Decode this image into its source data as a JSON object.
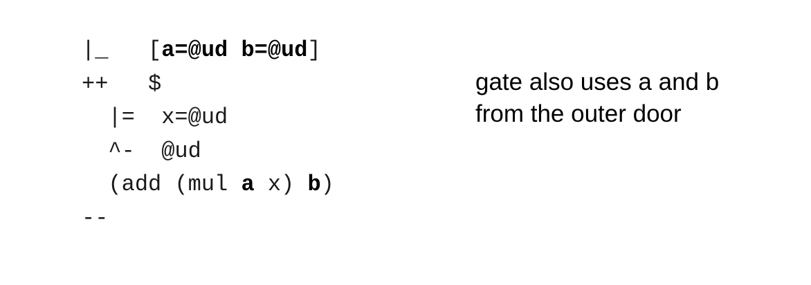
{
  "code_lines": [
    [
      {
        "t": "|_   [",
        "b": false
      },
      {
        "t": "a=@ud b=@ud",
        "b": true
      },
      {
        "t": "]",
        "b": false
      }
    ],
    [
      {
        "t": "++   $",
        "b": false
      }
    ],
    [
      {
        "t": "  |=  x=@ud",
        "b": false
      }
    ],
    [
      {
        "t": "  ^-  @ud",
        "b": false
      }
    ],
    [
      {
        "t": "  (add (mul ",
        "b": false
      },
      {
        "t": "a",
        "b": true
      },
      {
        "t": " x) ",
        "b": false
      },
      {
        "t": "b",
        "b": true
      },
      {
        "t": ")",
        "b": false
      }
    ],
    [
      {
        "t": "--",
        "b": false
      }
    ]
  ],
  "note": {
    "line1": "gate also uses a and b",
    "line2": "from the outer door"
  }
}
